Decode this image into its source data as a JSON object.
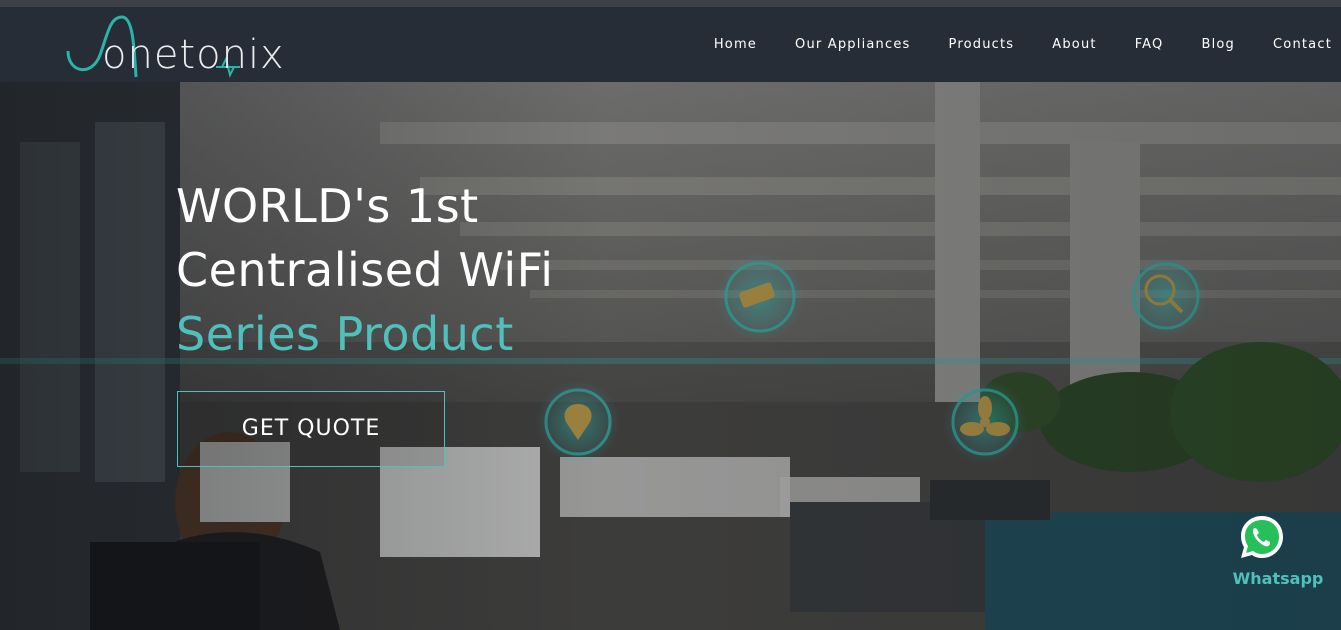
{
  "brand": {
    "name": "onetonix",
    "accent": "#4fc0bb"
  },
  "nav": {
    "items": [
      {
        "label": "Home"
      },
      {
        "label": "Our Appliances"
      },
      {
        "label": "Products"
      },
      {
        "label": "About"
      },
      {
        "label": "FAQ"
      },
      {
        "label": "Blog"
      },
      {
        "label": "Contact"
      }
    ]
  },
  "hero": {
    "line1": "WORLD's 1st",
    "line2": "Centralised WiFi",
    "line3": "Series Product",
    "cta_label": "GET QUOTE",
    "feature_icons": [
      "cctv-camera-icon",
      "location-pin-icon",
      "health-search-icon",
      "fan-icon"
    ]
  },
  "whatsapp": {
    "label": "Whatsapp",
    "icon": "whatsapp-icon"
  }
}
